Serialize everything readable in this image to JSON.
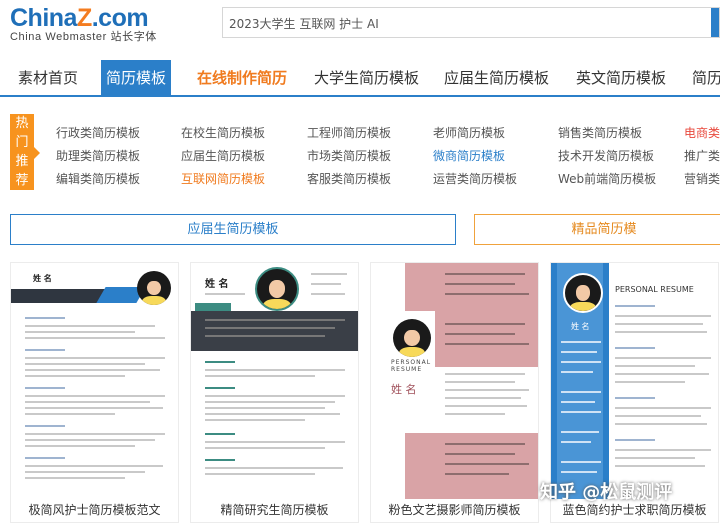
{
  "header": {
    "logo_main": "China",
    "logo_z": "Z",
    "logo_tail": ".com",
    "logo_sub": "China Webmaster 站长字体",
    "search_value": "2023大学生 互联网 护士 AI"
  },
  "nav": {
    "items": [
      {
        "label": "素材首页"
      },
      {
        "label": "简历模板"
      },
      {
        "label": "在线制作简历"
      },
      {
        "label": "大学生简历模板"
      },
      {
        "label": "应届生简历模板"
      },
      {
        "label": "英文简历模板"
      },
      {
        "label": "简历"
      }
    ]
  },
  "hot": {
    "badge": "热门推荐",
    "columns": [
      [
        "行政类简历模板",
        "助理类简历模板",
        "编辑类简历模板"
      ],
      [
        "在校生简历模板",
        "应届生简历模板",
        "互联网简历模板"
      ],
      [
        "工程师简历模板",
        "市场类简历模板",
        "客服类简历模板"
      ],
      [
        "老师简历模板",
        "微商简历模板",
        "运营类简历模板"
      ],
      [
        "销售类简历模板",
        "技术开发简历模板",
        "Web前端简历模板"
      ],
      [
        "电商类简",
        "推广类简",
        "营销类简"
      ]
    ]
  },
  "tabs": {
    "tab1": "应届生简历模板",
    "tab2": "精品简历模"
  },
  "cards": [
    {
      "title": "极简风护士简历模板范文",
      "name": "姓 名"
    },
    {
      "title": "精简研究生简历模板",
      "name": "姓 名"
    },
    {
      "title": "粉色文艺摄影师简历模板",
      "name": "姓 名",
      "en": "PERSONAL RESUME"
    },
    {
      "title": "蓝色简约护士求职简历模板",
      "name": "姓 名",
      "en": "PERSONAL RESUME"
    }
  ],
  "watermark": "知乎 @松鼠测评",
  "colors": {
    "brand_blue": "#2b7fc9",
    "accent_orange": "#f7931e",
    "pink": "#d9a3a6",
    "teal": "#3c8c82"
  }
}
